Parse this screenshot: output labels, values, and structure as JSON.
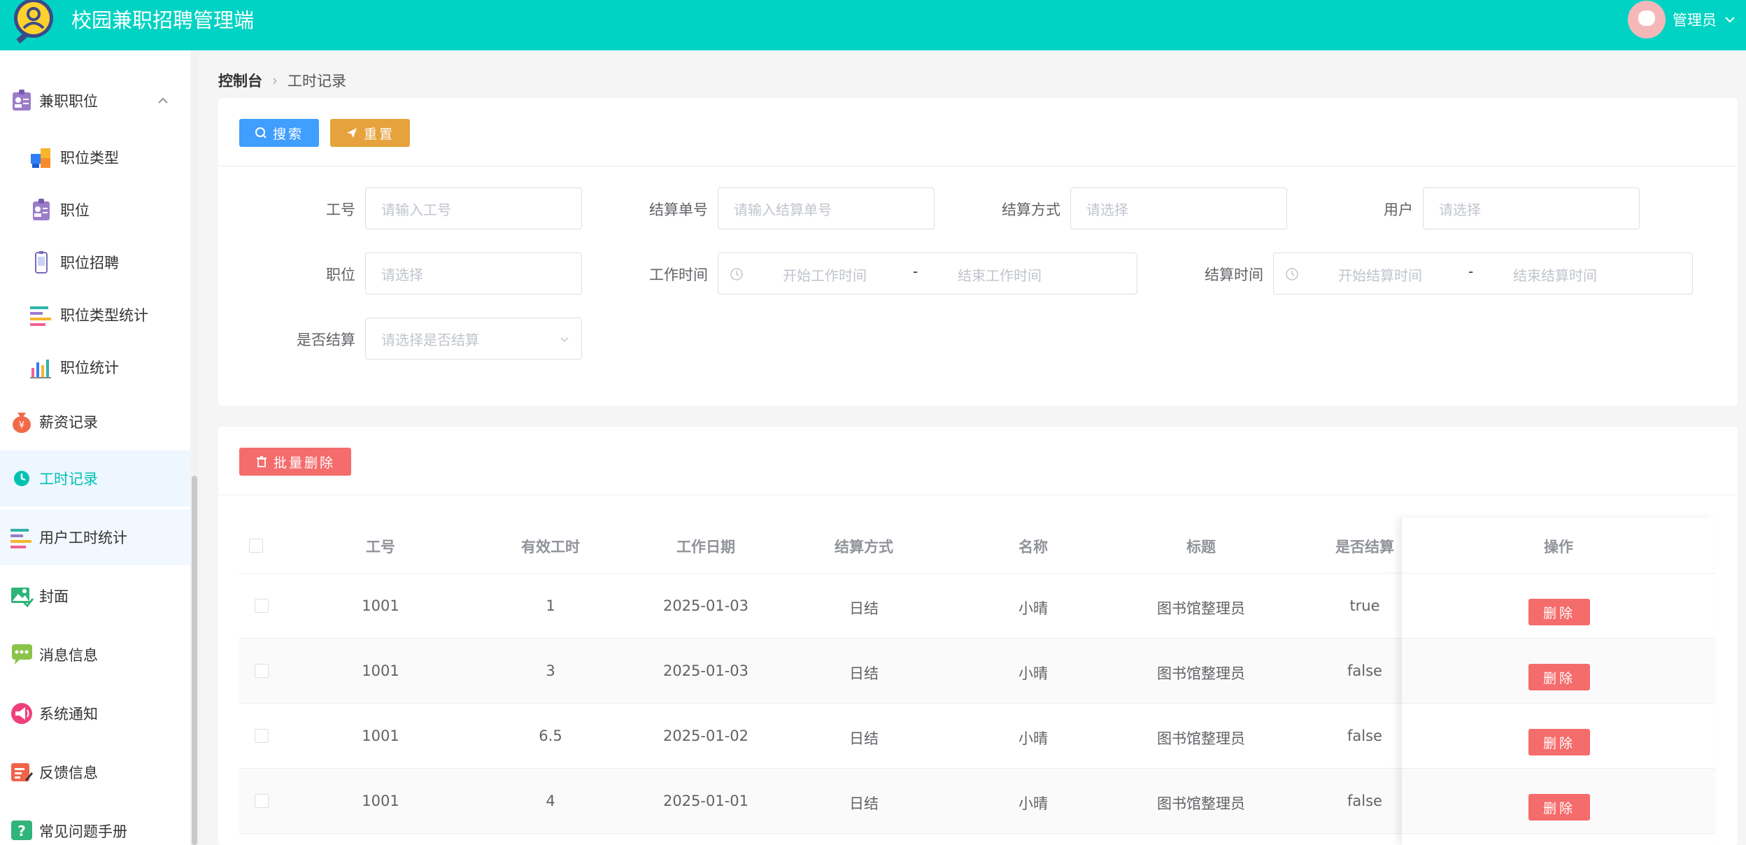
{
  "header": {
    "title": "校园兼职招聘管理端",
    "user": "管理员"
  },
  "colors": {
    "brand": "#00d3c3",
    "primary": "#409eff",
    "warning": "#e6a23c",
    "danger": "#f56c6c"
  },
  "sidebar": {
    "group": {
      "label": "兼职职位",
      "icon": "badge-icon"
    },
    "sub_items": [
      {
        "label": "职位类型",
        "icon": "cubes-icon"
      },
      {
        "label": "职位",
        "icon": "badge-icon"
      },
      {
        "label": "职位招聘",
        "icon": "phone-icon"
      },
      {
        "label": "职位类型统计",
        "icon": "bar-list-icon"
      },
      {
        "label": "职位统计",
        "icon": "bar-chart-icon"
      }
    ],
    "items": [
      {
        "label": "薪资记录",
        "icon": "money-bag-icon"
      },
      {
        "label": "工时记录",
        "icon": "clock-icon"
      },
      {
        "label": "用户工时统计",
        "icon": "bar-list-icon"
      },
      {
        "label": "封面",
        "icon": "picture-icon"
      },
      {
        "label": "消息信息",
        "icon": "chat-icon"
      },
      {
        "label": "系统通知",
        "icon": "megaphone-icon"
      },
      {
        "label": "反馈信息",
        "icon": "feedback-icon"
      },
      {
        "label": "常见问题手册",
        "icon": "question-icon"
      }
    ]
  },
  "breadcrumb": {
    "home": "控制台",
    "current": "工时记录"
  },
  "search": {
    "search_btn": "搜索",
    "reset_btn": "重置",
    "fields": {
      "job_no": {
        "label": "工号",
        "placeholder": "请输入工号"
      },
      "settle_no": {
        "label": "结算单号",
        "placeholder": "请输入结算单号"
      },
      "settle_method": {
        "label": "结算方式",
        "placeholder": "请选择"
      },
      "user": {
        "label": "用户",
        "placeholder": "请选择"
      },
      "position": {
        "label": "职位",
        "placeholder": "请选择"
      },
      "work_time": {
        "label": "工作时间",
        "start": "开始工作时间",
        "end": "结束工作时间",
        "sep": "-"
      },
      "settle_time": {
        "label": "结算时间",
        "start": "开始结算时间",
        "end": "结束结算时间",
        "sep": "-"
      },
      "is_settled": {
        "label": "是否结算",
        "placeholder": "请选择是否结算"
      }
    }
  },
  "table": {
    "batch_delete": "批量删除",
    "columns": [
      "工号",
      "有效工时",
      "工作日期",
      "结算方式",
      "名称",
      "标题",
      "是否结算",
      "操作"
    ],
    "delete_label": "删除",
    "rows": [
      {
        "job_no": "1001",
        "hours": "1",
        "date": "2025-01-03",
        "method": "日结",
        "name": "小晴",
        "title": "图书馆整理员",
        "settled": "true"
      },
      {
        "job_no": "1001",
        "hours": "3",
        "date": "2025-01-03",
        "method": "日结",
        "name": "小晴",
        "title": "图书馆整理员",
        "settled": "false"
      },
      {
        "job_no": "1001",
        "hours": "6.5",
        "date": "2025-01-02",
        "method": "日结",
        "name": "小晴",
        "title": "图书馆整理员",
        "settled": "false"
      },
      {
        "job_no": "1001",
        "hours": "4",
        "date": "2025-01-01",
        "method": "日结",
        "name": "小晴",
        "title": "图书馆整理员",
        "settled": "false"
      }
    ]
  }
}
